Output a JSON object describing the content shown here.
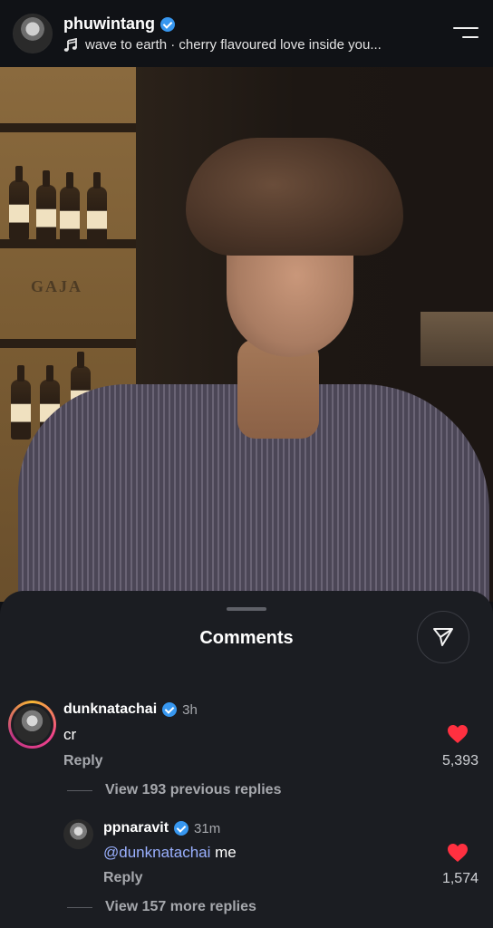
{
  "header": {
    "username": "phuwintang",
    "music": "wave to earth · cherry flavoured love inside you..."
  },
  "photo": {
    "crate_label": "GAJA"
  },
  "comments_sheet": {
    "title": "Comments"
  },
  "comments": [
    {
      "username": "dunknatachai",
      "time": "3h",
      "text": "cr",
      "reply_label": "Reply",
      "likes": "5,393",
      "view_replies": "View 193 previous replies"
    },
    {
      "username": "ppnaravit",
      "time": "31m",
      "mention": "@dunknatachai",
      "text": "me",
      "reply_label": "Reply",
      "likes": "1,574",
      "view_replies": "View 157 more replies"
    }
  ],
  "colors": {
    "background": "#0f1115",
    "sheet": "#1b1d22",
    "verified": "#3797f0",
    "heart": "#ff3040",
    "mention": "#9ab0ff"
  },
  "icons": [
    "music-note-icon",
    "menu-icon",
    "verified-badge-icon",
    "share-icon",
    "heart-icon"
  ]
}
